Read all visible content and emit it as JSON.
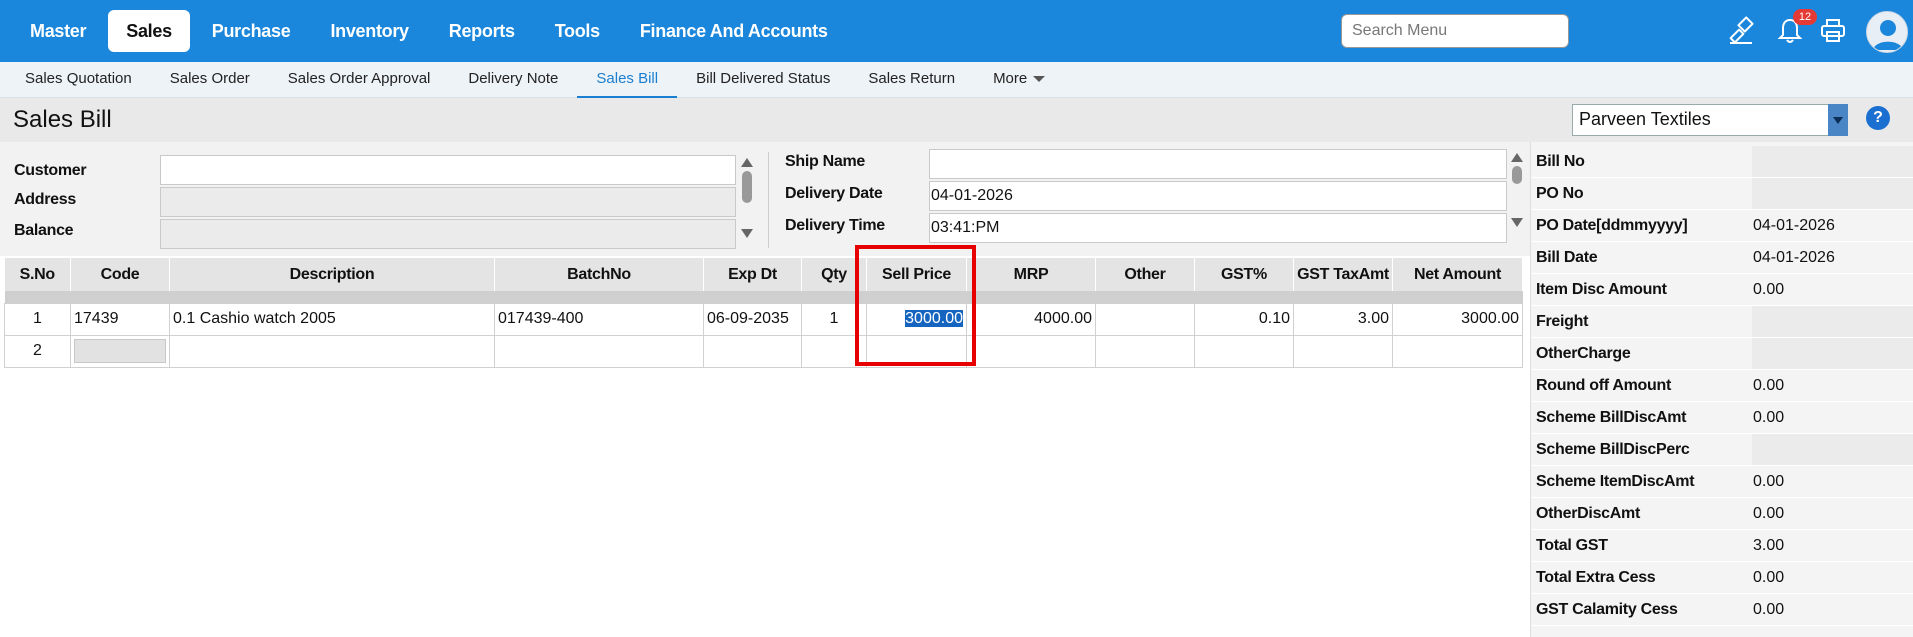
{
  "nav": {
    "items": [
      "Master",
      "Sales",
      "Purchase",
      "Inventory",
      "Reports",
      "Tools",
      "Finance And Accounts"
    ],
    "active": "Sales",
    "search_placeholder": "Search Menu",
    "notification_count": "12",
    "accent": "#1a87dc"
  },
  "subnav": {
    "items": [
      "Sales Quotation",
      "Sales Order",
      "Sales Order Approval",
      "Delivery Note",
      "Sales Bill",
      "Bill Delivered Status",
      "Sales Return",
      "More"
    ],
    "active": "Sales Bill"
  },
  "page": {
    "title": "Sales Bill",
    "company": "Parveen Textiles",
    "help": "?"
  },
  "form": {
    "customer_label": "Customer",
    "address_label": "Address",
    "balance_label": "Balance",
    "customer_value": "",
    "ship_name_label": "Ship Name",
    "delivery_date_label": "Delivery Date",
    "delivery_time_label": "Delivery Time",
    "ship_name_value": "",
    "delivery_date_value": "04-01-2026",
    "delivery_time_value": "03:41:PM"
  },
  "grid": {
    "columns": [
      "S.No",
      "Code",
      "Description",
      "BatchNo",
      "Exp Dt",
      "Qty",
      "Sell Price",
      "MRP",
      "Other",
      "GST%",
      "GST TaxAmt",
      "Net Amount"
    ],
    "rows": [
      {
        "sno": "1",
        "code": "17439",
        "description": "0.1 Cashio watch 2005",
        "batch": "017439-400",
        "exp": "06-09-2035",
        "qty": "1",
        "sell_price": "3000.00",
        "mrp": "4000.00",
        "other": "",
        "gst": "0.10",
        "gst_tax": "3.00",
        "net": "3000.00"
      },
      {
        "sno": "2",
        "code": "",
        "description": "",
        "batch": "",
        "exp": "",
        "qty": "",
        "sell_price": "",
        "mrp": "",
        "other": "",
        "gst": "",
        "gst_tax": "",
        "net": ""
      }
    ]
  },
  "summary": [
    {
      "label": "Bill No",
      "value": "",
      "filled": true
    },
    {
      "label": "PO No",
      "value": "",
      "filled": true
    },
    {
      "label": "PO Date[ddmmyyyy]",
      "value": "04-01-2026",
      "filled": false
    },
    {
      "label": "Bill Date",
      "value": "04-01-2026",
      "filled": false
    },
    {
      "label": "Item Disc Amount",
      "value": "0.00",
      "filled": false
    },
    {
      "label": "Freight",
      "value": "",
      "filled": true
    },
    {
      "label": "OtherCharge",
      "value": "",
      "filled": true
    },
    {
      "label": "Round off Amount",
      "value": "0.00",
      "filled": false
    },
    {
      "label": "Scheme BillDiscAmt",
      "value": "0.00",
      "filled": false
    },
    {
      "label": "Scheme BillDiscPerc",
      "value": "",
      "filled": true
    },
    {
      "label": "Scheme ItemDiscAmt",
      "value": "0.00",
      "filled": false
    },
    {
      "label": "OtherDiscAmt",
      "value": "0.00",
      "filled": false
    },
    {
      "label": "Total GST",
      "value": "3.00",
      "filled": false
    },
    {
      "label": "Total Extra Cess",
      "value": "0.00",
      "filled": false
    },
    {
      "label": "GST Calamity Cess",
      "value": "0.00",
      "filled": false
    }
  ]
}
